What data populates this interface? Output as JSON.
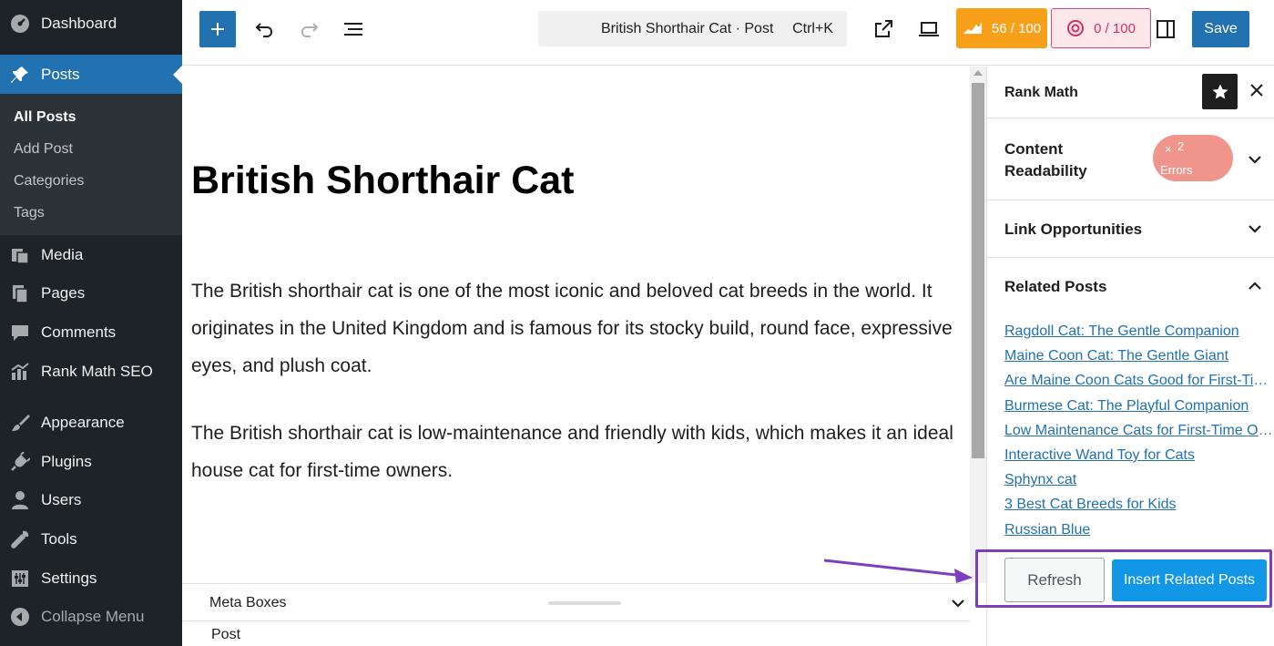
{
  "sidebar": {
    "items": [
      {
        "label": "Dashboard",
        "icon": "dashboard-icon"
      },
      {
        "label": "Posts",
        "icon": "pin-icon"
      },
      {
        "label": "Media",
        "icon": "media-icon"
      },
      {
        "label": "Pages",
        "icon": "pages-icon"
      },
      {
        "label": "Comments",
        "icon": "comment-icon"
      },
      {
        "label": "Rank Math SEO",
        "icon": "chart-icon"
      },
      {
        "label": "Appearance",
        "icon": "brush-icon"
      },
      {
        "label": "Plugins",
        "icon": "plugin-icon"
      },
      {
        "label": "Users",
        "icon": "user-icon"
      },
      {
        "label": "Tools",
        "icon": "wrench-icon"
      },
      {
        "label": "Settings",
        "icon": "sliders-icon"
      },
      {
        "label": "Collapse Menu",
        "icon": "collapse-icon"
      }
    ],
    "submenu": [
      "All Posts",
      "Add Post",
      "Categories",
      "Tags"
    ],
    "colors": {
      "background": "#1d2327",
      "active": "#2271b1"
    }
  },
  "toolbar": {
    "command_title": "British Shorthair Cat · Post",
    "command_shortcut": "Ctrl+K",
    "seo_score": "56 / 100",
    "readability_score": "0 / 100",
    "save_label": "Save"
  },
  "editor": {
    "title": "British Shorthair Cat",
    "paragraphs": [
      "The British shorthair cat is one of the most iconic and beloved cat breeds in the world. It originates in the United Kingdom and is famous for its stocky build, round face, expressive eyes, and plush coat.",
      "The British shorthair cat is low-maintenance and friendly with kids, which makes it an ideal house cat for first-time owners."
    ]
  },
  "meta": {
    "label": "Meta Boxes",
    "breadcrumb": "Post"
  },
  "panel": {
    "title": "Rank Math",
    "content_readability": "Content Readability",
    "errors_count": "2",
    "errors_label": "Errors",
    "link_opportunities": "Link Opportunities",
    "related_posts": "Related Posts",
    "related_links": [
      "Ragdoll Cat: The Gentle Companion",
      "Maine Coon Cat: The Gentle Giant",
      "Are Maine Coon Cats Good for First-Time Owners?",
      "Burmese Cat: The Playful Companion",
      "Low Maintenance Cats for First-Time Owners",
      "Interactive Wand Toy for Cats",
      "Sphynx cat",
      "3 Best Cat Breeds for Kids",
      "Russian Blue"
    ],
    "refresh_label": "Refresh",
    "insert_label": "Insert Related Posts"
  },
  "annotation": {
    "color": "#7b3fbf"
  }
}
